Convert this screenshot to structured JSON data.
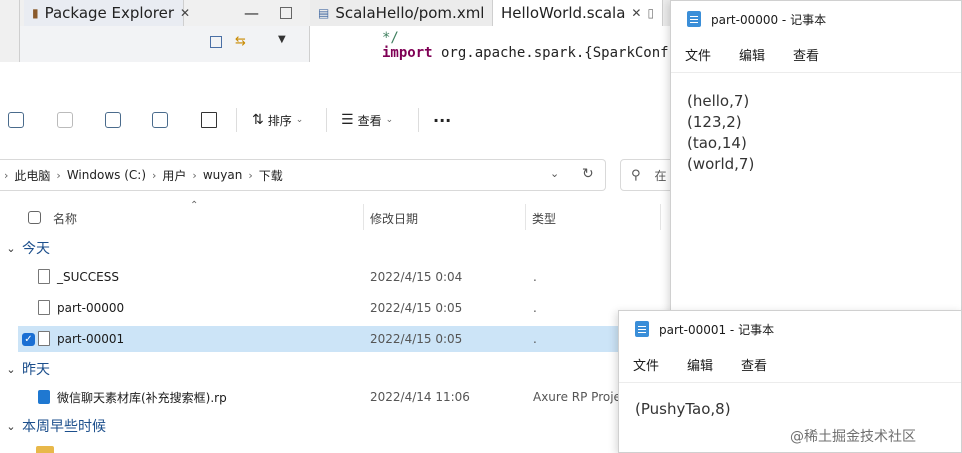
{
  "eclipse": {
    "package_tab": "Package Explorer",
    "pom_tab": "ScalaHello/pom.xml",
    "helloworld_tab": "HelloWorld.scala",
    "code": {
      "comment_close": "*/",
      "import_kw": "import",
      "import_rest": " org.apache.spark.{SparkConf,"
    }
  },
  "explorer": {
    "toolbar": {
      "sort_label": "排序",
      "view_label": "查看",
      "more_label": "···"
    },
    "address": {
      "crumbs": [
        "此电脑",
        "Windows (C:)",
        "用户",
        "wuyan",
        "下载"
      ],
      "search_partial": "在"
    },
    "columns": {
      "name": "名称",
      "modified": "修改日期",
      "type": "类型"
    },
    "groups": {
      "today": "今天",
      "yesterday": "昨天",
      "earlier_this_week": "本周早些时候"
    },
    "rows": [
      {
        "name": "_SUCCESS",
        "date": "2022/4/15 0:04",
        "type": "."
      },
      {
        "name": "part-00000",
        "date": "2022/4/15 0:05",
        "type": "."
      },
      {
        "name": "part-00001",
        "date": "2022/4/15 0:05",
        "type": "."
      },
      {
        "name": "微信聊天素材库(补充搜索框).rp",
        "date": "2022/4/14 11:06",
        "type": "Axure RP Proje"
      }
    ]
  },
  "notepad1": {
    "title": "part-00000 - 记事本",
    "menu": [
      "文件",
      "编辑",
      "查看"
    ],
    "content": "(hello,7)\n(123,2)\n(tao,14)\n(world,7)"
  },
  "notepad2": {
    "title": "part-00001 - 记事本",
    "menu": [
      "文件",
      "编辑",
      "查看"
    ],
    "content": "(PushyTao,8)"
  },
  "watermark": "@稀土掘金技术社区",
  "colors": {
    "selection": "#cce4f7",
    "group_text": "#1c4f8c",
    "accent": "#1a6fd3"
  }
}
